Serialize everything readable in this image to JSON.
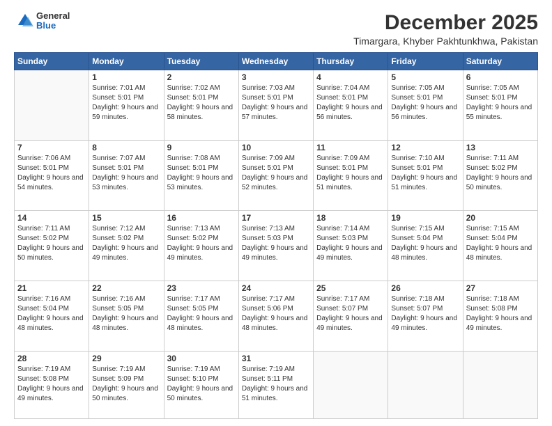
{
  "logo": {
    "general": "General",
    "blue": "Blue"
  },
  "header": {
    "month": "December 2025",
    "location": "Timargara, Khyber Pakhtunkhwa, Pakistan"
  },
  "weekdays": [
    "Sunday",
    "Monday",
    "Tuesday",
    "Wednesday",
    "Thursday",
    "Friday",
    "Saturday"
  ],
  "weeks": [
    [
      {
        "day": "",
        "sunrise": "",
        "sunset": "",
        "daylight": ""
      },
      {
        "day": "1",
        "sunrise": "Sunrise: 7:01 AM",
        "sunset": "Sunset: 5:01 PM",
        "daylight": "Daylight: 9 hours and 59 minutes."
      },
      {
        "day": "2",
        "sunrise": "Sunrise: 7:02 AM",
        "sunset": "Sunset: 5:01 PM",
        "daylight": "Daylight: 9 hours and 58 minutes."
      },
      {
        "day": "3",
        "sunrise": "Sunrise: 7:03 AM",
        "sunset": "Sunset: 5:01 PM",
        "daylight": "Daylight: 9 hours and 57 minutes."
      },
      {
        "day": "4",
        "sunrise": "Sunrise: 7:04 AM",
        "sunset": "Sunset: 5:01 PM",
        "daylight": "Daylight: 9 hours and 56 minutes."
      },
      {
        "day": "5",
        "sunrise": "Sunrise: 7:05 AM",
        "sunset": "Sunset: 5:01 PM",
        "daylight": "Daylight: 9 hours and 56 minutes."
      },
      {
        "day": "6",
        "sunrise": "Sunrise: 7:05 AM",
        "sunset": "Sunset: 5:01 PM",
        "daylight": "Daylight: 9 hours and 55 minutes."
      }
    ],
    [
      {
        "day": "7",
        "sunrise": "Sunrise: 7:06 AM",
        "sunset": "Sunset: 5:01 PM",
        "daylight": "Daylight: 9 hours and 54 minutes."
      },
      {
        "day": "8",
        "sunrise": "Sunrise: 7:07 AM",
        "sunset": "Sunset: 5:01 PM",
        "daylight": "Daylight: 9 hours and 53 minutes."
      },
      {
        "day": "9",
        "sunrise": "Sunrise: 7:08 AM",
        "sunset": "Sunset: 5:01 PM",
        "daylight": "Daylight: 9 hours and 53 minutes."
      },
      {
        "day": "10",
        "sunrise": "Sunrise: 7:09 AM",
        "sunset": "Sunset: 5:01 PM",
        "daylight": "Daylight: 9 hours and 52 minutes."
      },
      {
        "day": "11",
        "sunrise": "Sunrise: 7:09 AM",
        "sunset": "Sunset: 5:01 PM",
        "daylight": "Daylight: 9 hours and 51 minutes."
      },
      {
        "day": "12",
        "sunrise": "Sunrise: 7:10 AM",
        "sunset": "Sunset: 5:01 PM",
        "daylight": "Daylight: 9 hours and 51 minutes."
      },
      {
        "day": "13",
        "sunrise": "Sunrise: 7:11 AM",
        "sunset": "Sunset: 5:02 PM",
        "daylight": "Daylight: 9 hours and 50 minutes."
      }
    ],
    [
      {
        "day": "14",
        "sunrise": "Sunrise: 7:11 AM",
        "sunset": "Sunset: 5:02 PM",
        "daylight": "Daylight: 9 hours and 50 minutes."
      },
      {
        "day": "15",
        "sunrise": "Sunrise: 7:12 AM",
        "sunset": "Sunset: 5:02 PM",
        "daylight": "Daylight: 9 hours and 49 minutes."
      },
      {
        "day": "16",
        "sunrise": "Sunrise: 7:13 AM",
        "sunset": "Sunset: 5:02 PM",
        "daylight": "Daylight: 9 hours and 49 minutes."
      },
      {
        "day": "17",
        "sunrise": "Sunrise: 7:13 AM",
        "sunset": "Sunset: 5:03 PM",
        "daylight": "Daylight: 9 hours and 49 minutes."
      },
      {
        "day": "18",
        "sunrise": "Sunrise: 7:14 AM",
        "sunset": "Sunset: 5:03 PM",
        "daylight": "Daylight: 9 hours and 49 minutes."
      },
      {
        "day": "19",
        "sunrise": "Sunrise: 7:15 AM",
        "sunset": "Sunset: 5:04 PM",
        "daylight": "Daylight: 9 hours and 48 minutes."
      },
      {
        "day": "20",
        "sunrise": "Sunrise: 7:15 AM",
        "sunset": "Sunset: 5:04 PM",
        "daylight": "Daylight: 9 hours and 48 minutes."
      }
    ],
    [
      {
        "day": "21",
        "sunrise": "Sunrise: 7:16 AM",
        "sunset": "Sunset: 5:04 PM",
        "daylight": "Daylight: 9 hours and 48 minutes."
      },
      {
        "day": "22",
        "sunrise": "Sunrise: 7:16 AM",
        "sunset": "Sunset: 5:05 PM",
        "daylight": "Daylight: 9 hours and 48 minutes."
      },
      {
        "day": "23",
        "sunrise": "Sunrise: 7:17 AM",
        "sunset": "Sunset: 5:05 PM",
        "daylight": "Daylight: 9 hours and 48 minutes."
      },
      {
        "day": "24",
        "sunrise": "Sunrise: 7:17 AM",
        "sunset": "Sunset: 5:06 PM",
        "daylight": "Daylight: 9 hours and 48 minutes."
      },
      {
        "day": "25",
        "sunrise": "Sunrise: 7:17 AM",
        "sunset": "Sunset: 5:07 PM",
        "daylight": "Daylight: 9 hours and 49 minutes."
      },
      {
        "day": "26",
        "sunrise": "Sunrise: 7:18 AM",
        "sunset": "Sunset: 5:07 PM",
        "daylight": "Daylight: 9 hours and 49 minutes."
      },
      {
        "day": "27",
        "sunrise": "Sunrise: 7:18 AM",
        "sunset": "Sunset: 5:08 PM",
        "daylight": "Daylight: 9 hours and 49 minutes."
      }
    ],
    [
      {
        "day": "28",
        "sunrise": "Sunrise: 7:19 AM",
        "sunset": "Sunset: 5:08 PM",
        "daylight": "Daylight: 9 hours and 49 minutes."
      },
      {
        "day": "29",
        "sunrise": "Sunrise: 7:19 AM",
        "sunset": "Sunset: 5:09 PM",
        "daylight": "Daylight: 9 hours and 50 minutes."
      },
      {
        "day": "30",
        "sunrise": "Sunrise: 7:19 AM",
        "sunset": "Sunset: 5:10 PM",
        "daylight": "Daylight: 9 hours and 50 minutes."
      },
      {
        "day": "31",
        "sunrise": "Sunrise: 7:19 AM",
        "sunset": "Sunset: 5:11 PM",
        "daylight": "Daylight: 9 hours and 51 minutes."
      },
      {
        "day": "",
        "sunrise": "",
        "sunset": "",
        "daylight": ""
      },
      {
        "day": "",
        "sunrise": "",
        "sunset": "",
        "daylight": ""
      },
      {
        "day": "",
        "sunrise": "",
        "sunset": "",
        "daylight": ""
      }
    ]
  ]
}
